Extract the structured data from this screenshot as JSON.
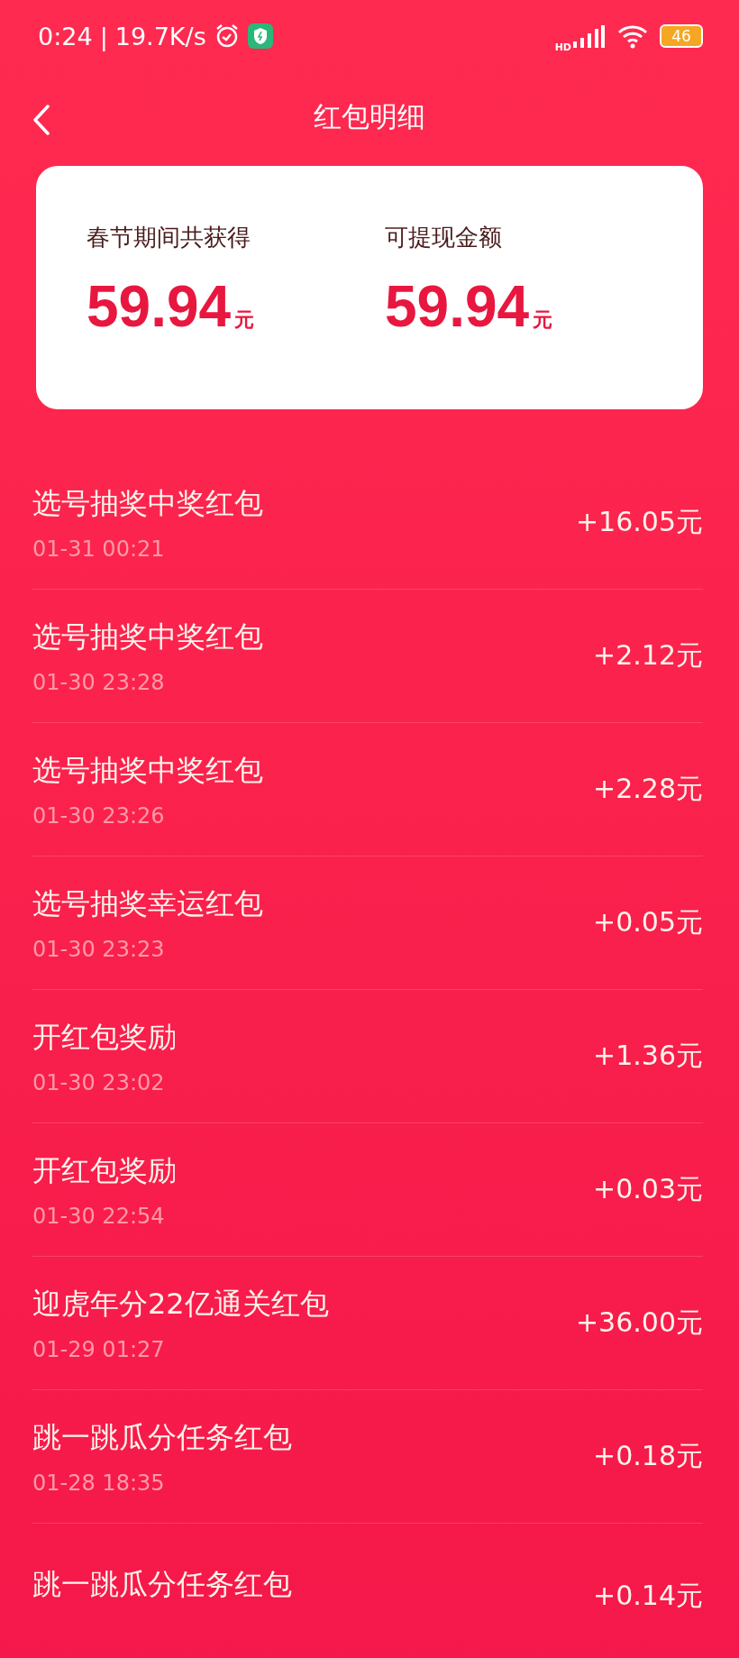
{
  "status_bar": {
    "time": "0:24",
    "separator": "|",
    "speed": "19.7K/s",
    "network_type": "HD",
    "battery": "46"
  },
  "header": {
    "title": "红包明细"
  },
  "summary": [
    {
      "label": "春节期间共获得",
      "amount": "59.94",
      "unit": "元"
    },
    {
      "label": "可提现金额",
      "amount": "59.94",
      "unit": "元"
    }
  ],
  "records": [
    {
      "title": "选号抽奖中奖红包",
      "time": "01-31 00:21",
      "amount": "+16.05元"
    },
    {
      "title": "选号抽奖中奖红包",
      "time": "01-30 23:28",
      "amount": "+2.12元"
    },
    {
      "title": "选号抽奖中奖红包",
      "time": "01-30 23:26",
      "amount": "+2.28元"
    },
    {
      "title": "选号抽奖幸运红包",
      "time": "01-30 23:23",
      "amount": "+0.05元"
    },
    {
      "title": "开红包奖励",
      "time": "01-30 23:02",
      "amount": "+1.36元"
    },
    {
      "title": "开红包奖励",
      "time": "01-30 22:54",
      "amount": "+0.03元"
    },
    {
      "title": "迎虎年分22亿通关红包",
      "time": "01-29 01:27",
      "amount": "+36.00元"
    },
    {
      "title": "跳一跳瓜分任务红包",
      "time": "01-28 18:35",
      "amount": "+0.18元"
    },
    {
      "title": "跳一跳瓜分任务红包",
      "amount": "+0.14元"
    }
  ]
}
